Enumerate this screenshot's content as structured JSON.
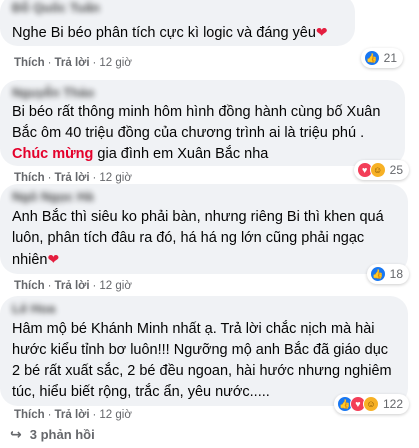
{
  "actions": {
    "like": "Thích",
    "reply": "Trả lời",
    "separator": "·"
  },
  "comments": [
    {
      "author": "Đỗ Quốc Tuấn",
      "text": "Nghe Bi béo phân tích cực kì logic và đáng yêu",
      "time": "12 giờ",
      "reaction_count": "21"
    },
    {
      "author": "Nguyễn Thảo",
      "text_before": "Bi béo rất thông minh hôm hình đồng hành cùng bố Xuân Bắc ôm 40 triệu đồng của chương trình ai là triệu phú . ",
      "highlight": "Chúc mừng",
      "text_after": " gia đình em Xuân Bắc nha",
      "time": "12 giờ",
      "reaction_count": "25"
    },
    {
      "author": "Ngô Ngọc Hà",
      "text": "Anh Bắc thì siêu ko phải bàn, nhưng riêng Bi thì khen quá luôn, phân tích đâu ra đó, há há ng lớn cũng phải ngạc nhiên",
      "time": "12 giờ",
      "reaction_count": "18"
    },
    {
      "author": "Lê Hoa",
      "text": "Hâm mộ bé Khánh Minh nhất ạ. Trả lời chắc nịch mà hài hước kiểu tỉnh bơ luôn!!! Ngưỡng mộ anh Bắc đã giáo dục 2 bé rất xuất sắc, 2 bé đều ngoan, hài hước nhưng nghiêm túc, hiểu biết rộng, trắc ẩn, yêu nước.....",
      "time": "12 giờ",
      "reaction_count": "122"
    }
  ],
  "replies": {
    "label": "3 phản hồi"
  },
  "colors": {
    "bubble": "#f0f2f5",
    "highlight": "#e4002b",
    "like": "#1877f2",
    "love": "#f33e58",
    "care": "#f7b125"
  },
  "icons": {
    "like": "like-icon",
    "love": "love-icon",
    "care": "care-icon",
    "heart": "heart-emoji-icon",
    "reply": "reply-arrow-icon"
  }
}
